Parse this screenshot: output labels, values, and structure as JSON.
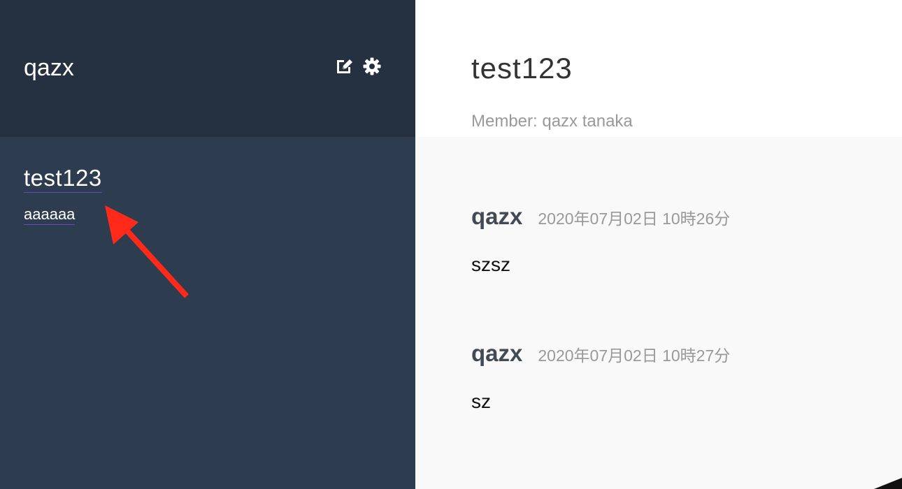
{
  "sidebar": {
    "current_user": "qazx",
    "icons": [
      "edit-icon",
      "gear-icon"
    ],
    "groups": [
      {
        "name": "test123",
        "last_message": "aaaaaa"
      }
    ]
  },
  "main": {
    "group_name": "test123",
    "members_label": "Member:",
    "members": "qazx tanaka",
    "messages": [
      {
        "user": "qazx",
        "time": "2020年07月02日 10時26分",
        "text": "szsz"
      },
      {
        "user": "qazx",
        "time": "2020年07月02日 10時27分",
        "text": "sz"
      }
    ]
  },
  "colors": {
    "sidebar_header": "#253141",
    "sidebar_body": "#2d3c4f",
    "main_messages_bg": "#f9f9f9",
    "annotation_arrow": "#ff2a1a"
  }
}
